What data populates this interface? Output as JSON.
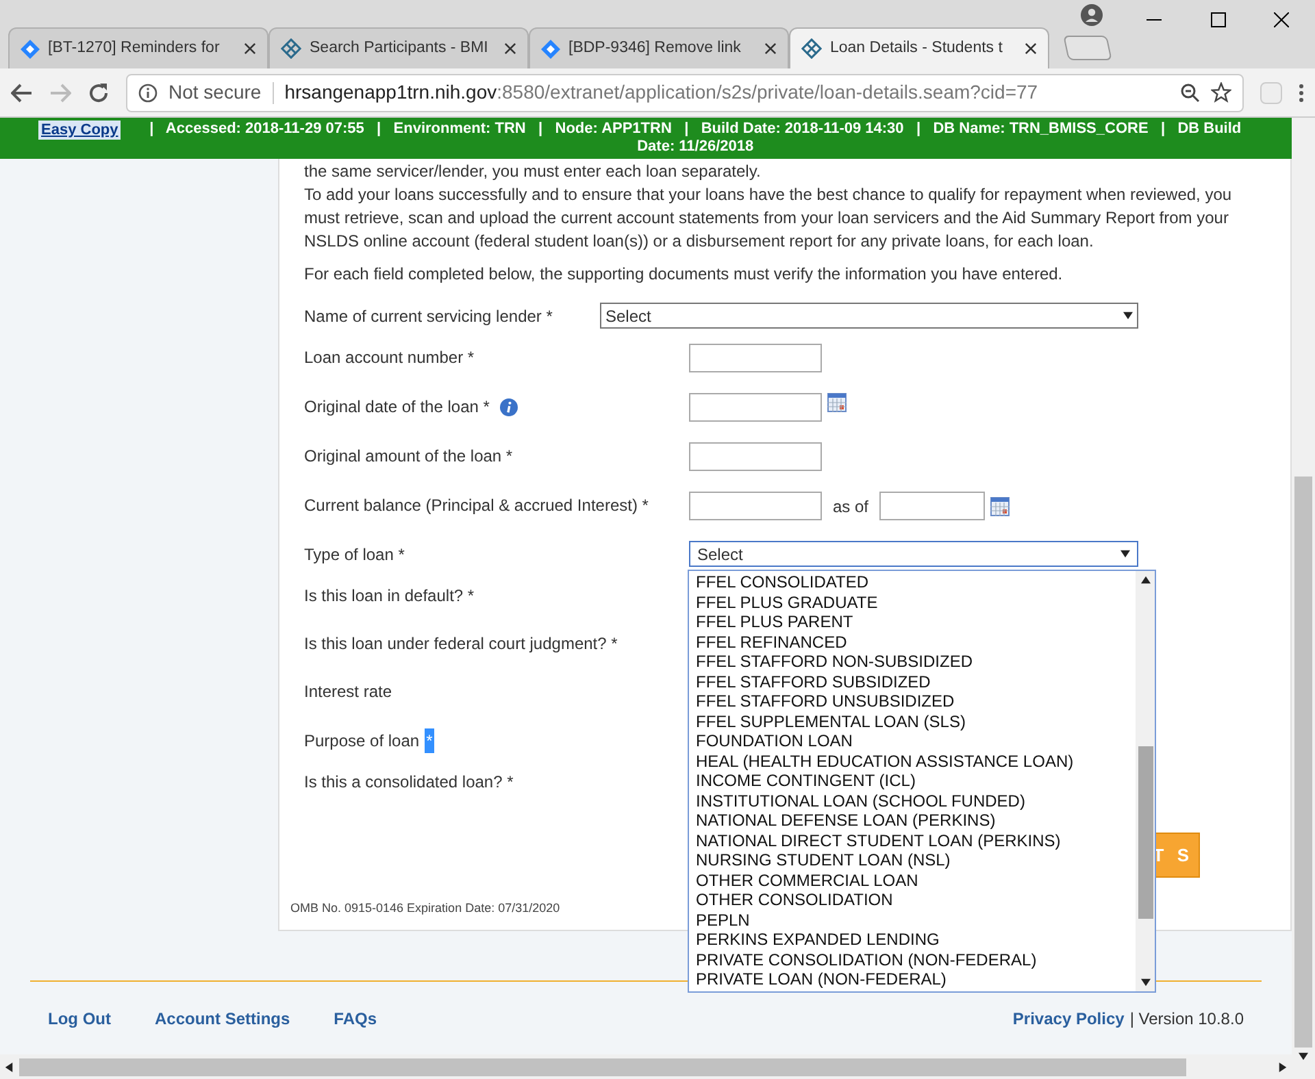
{
  "browser": {
    "tabs": [
      {
        "title": "[BT-1270] Reminders for",
        "kind": "diamond",
        "selected": false
      },
      {
        "title": "Search Participants - BMI",
        "kind": "emblem",
        "selected": false
      },
      {
        "title": "[BDP-9346] Remove link",
        "kind": "diamond",
        "selected": false
      },
      {
        "title": "Loan Details - Students t",
        "kind": "emblem",
        "selected": true
      }
    ],
    "security": "Not secure",
    "url_host": "hrsangenapp1trn.nih.gov",
    "url_path": ":8580/extranet/application/s2s/private/loan-details.seam?cid=77"
  },
  "env_bar": {
    "link": "Easy Copy",
    "info": "|   Accessed: 2018-11-29 07:55   |   Environment: TRN   |   Node: APP1TRN   |   Build Date: 2018-11-09 14:30   |   DB Name: TRN_BMISS_CORE   |   DB Build Date: 11/26/2018"
  },
  "intro": [
    "the same servicer/lender, you must enter each loan separately.",
    "To add your loans successfully and to ensure that your loans have the best chance to qualify for repayment when reviewed, you must retrieve, scan and upload the current account statements from your loan servicers and the Aid Summary Report from your NSLDS online account (federal student loan(s)) or a disbursement report for any private loans, for each loan.",
    "For each field completed below, the supporting documents must verify the information you have entered."
  ],
  "fields": [
    {
      "label": "Name of current servicing lender *",
      "kind": "select",
      "value": "Select"
    },
    {
      "label": "Loan account number *",
      "kind": "text"
    },
    {
      "label": "Original date of the loan *",
      "kind": "date",
      "info": true
    },
    {
      "label": "Original amount of the loan *",
      "kind": "text"
    },
    {
      "label": "Current balance (Principal & accrued Interest) *",
      "kind": "balance",
      "as_of": "as of"
    },
    {
      "label": "Type of loan *",
      "kind": "open_select",
      "value": "Select"
    },
    {
      "label": "Is this loan in default? *",
      "kind": "none"
    },
    {
      "label": "Is this loan under federal court judgment? *",
      "kind": "none"
    },
    {
      "label": "Interest rate",
      "kind": "none"
    },
    {
      "label": "Purpose of loan",
      "kind": "none",
      "mark": "*"
    },
    {
      "label": "Is this a consolidated loan? *",
      "kind": "none"
    }
  ],
  "action_button": "T S",
  "omb": "OMB No. 0915-0146 Expiration Date: 07/31/2020",
  "loan_type_options": [
    "FFEL CONSOLIDATED",
    "FFEL PLUS GRADUATE",
    "FFEL PLUS PARENT",
    "FFEL REFINANCED",
    "FFEL STAFFORD NON-SUBSIDIZED",
    "FFEL STAFFORD SUBSIDIZED",
    "FFEL STAFFORD UNSUBSIDIZED",
    "FFEL SUPPLEMENTAL LOAN (SLS)",
    "FOUNDATION LOAN",
    "HEAL (HEALTH EDUCATION ASSISTANCE LOAN)",
    "INCOME CONTINGENT (ICL)",
    "INSTITUTIONAL LOAN (SCHOOL FUNDED)",
    "NATIONAL DEFENSE LOAN (PERKINS)",
    "NATIONAL DIRECT STUDENT LOAN (PERKINS)",
    "NURSING STUDENT LOAN (NSL)",
    "OTHER COMMERCIAL LOAN",
    "OTHER CONSOLIDATION",
    "PEPLN",
    "PERKINS EXPANDED LENDING",
    "PRIVATE CONSOLIDATION (NON-FEDERAL)",
    "PRIVATE LOAN (NON-FEDERAL)"
  ],
  "footer": {
    "links": [
      "Log Out",
      "Account Settings",
      "FAQs"
    ],
    "privacy": "Privacy Policy",
    "version": "| Version 10.8.0"
  }
}
